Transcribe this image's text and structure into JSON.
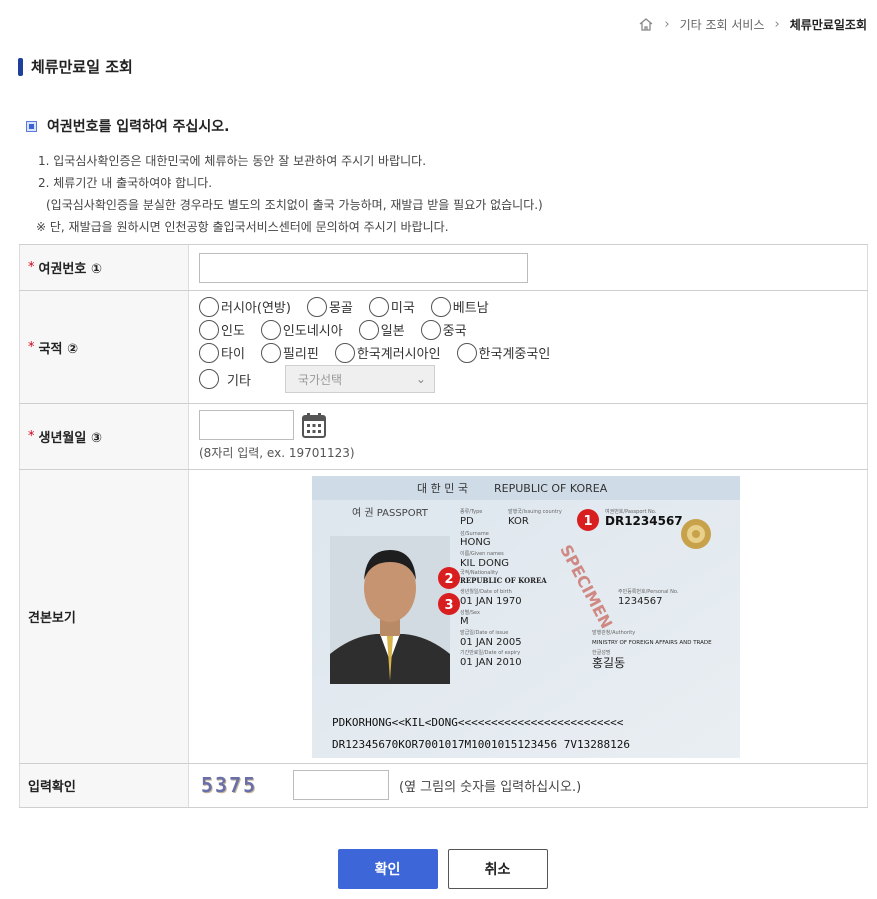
{
  "breadcrumb": {
    "home_icon": "home-icon",
    "level1": "기타 조회 서비스",
    "current": "체류만료일조회"
  },
  "page": {
    "title": "체류만료일 조회"
  },
  "section": {
    "heading": "여권번호를 입력하여 주십시오."
  },
  "instructions": [
    "1. 입국심사확인증은 대한민국에 체류하는 동안 잘 보관하여 주시기 바랍니다.",
    "2. 체류기간 내 출국하여야 합니다.",
    "(입국심사확인증을 분실한 경우라도 별도의 조치없이 출국 가능하며, 재발급 받을 필요가 없습니다.)",
    "※ 단, 재발급을 원하시면 인천공항 출입국서비스센터에 문의하여 주시기 바랍니다."
  ],
  "form": {
    "required_mark": "*",
    "passport": {
      "label": "여권번호 ①",
      "value": ""
    },
    "nationality": {
      "label": "국적 ②",
      "options": [
        "러시아(연방)",
        "몽골",
        "미국",
        "베트남",
        "인도",
        "인도네시아",
        "일본",
        "중국",
        "타이",
        "필리핀",
        "한국계러시아인",
        "한국계중국인"
      ],
      "other_label": "기타",
      "select_placeholder": "국가선택"
    },
    "birth": {
      "label": "생년월일 ③",
      "value": "",
      "hint": "(8자리 입력, ex. 19701123)"
    },
    "sample": {
      "label": "견본보기",
      "country_ko": "대 한 민 국",
      "country_en": "REPUBLIC OF KOREA",
      "doc_label": "여 권 PASSPORT",
      "type_label": "종류/Type",
      "type": "PD",
      "issuing_label": "발행국/Issuing country",
      "issuing": "KOR",
      "passport_no_label": "여권번호/Passport No.",
      "passport_no": "DR1234567",
      "surname_label": "성/Surname",
      "surname": "HONG",
      "given_label": "이름/Given names",
      "given": "KIL DONG",
      "nationality_label": "국적/Nationality",
      "nationality": "REPUBLIC OF KOREA",
      "dob_label": "생년월일/Date of birth",
      "dob": "01 JAN 1970",
      "personal_label": "주민등록번호/Personal No.",
      "personal_no": "1234567",
      "sex_label": "성별/Sex",
      "sex": "M",
      "issue_label": "발급일/Date of issue",
      "issue": "01 JAN 2005",
      "authority_label": "발행관청/Authority",
      "authority": "MINISTRY OF FOREIGN AFFAIRS AND TRADE",
      "expiry_label": "기간만료일/Date of expiry",
      "expiry": "01 JAN 2010",
      "korean_name_label": "한글성명",
      "korean_name": "홍길동",
      "specimen": "SPECIMEN",
      "mrz1": "PDKORHONG<<KIL<DONG<<<<<<<<<<<<<<<<<<<<<<<<<",
      "mrz2": "DR12345670KOR7001017M1001015123456 7V13288126",
      "markers": [
        "1",
        "2",
        "3"
      ]
    },
    "captcha": {
      "label": "입력확인",
      "code": "5375",
      "value": "",
      "hint": "(옆 그림의 숫자를 입력하십시오.)"
    }
  },
  "buttons": {
    "confirm": "확인",
    "cancel": "취소"
  },
  "colors": {
    "primary": "#3d66d9",
    "title_bar": "#1f3f9c",
    "required": "#d0021b"
  }
}
